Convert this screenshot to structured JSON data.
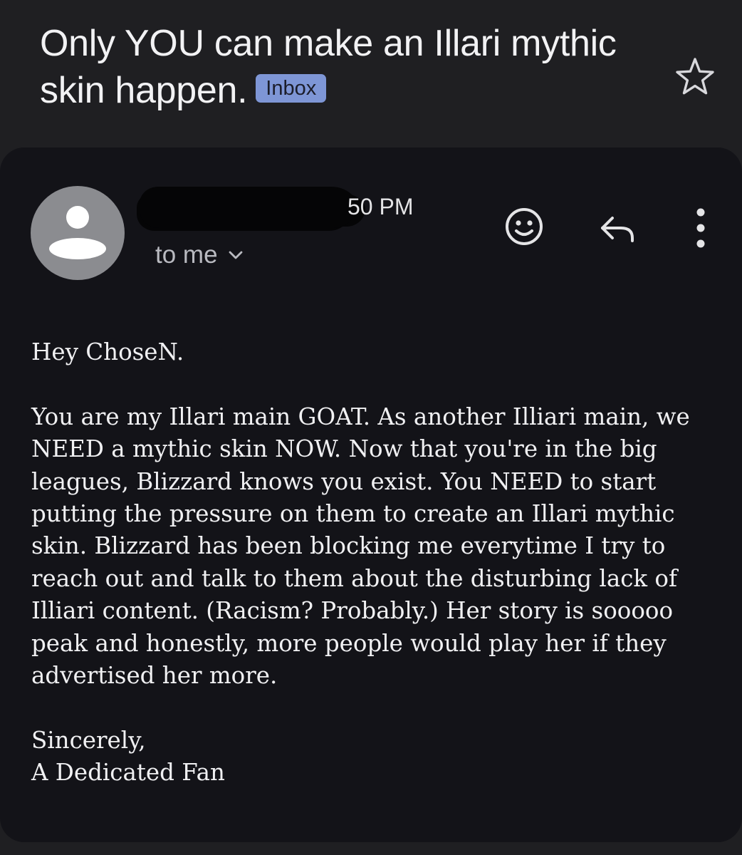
{
  "email": {
    "subject": "Only YOU can make an Illari mythic skin happen.",
    "label": "Inbox",
    "time": "50 PM",
    "recipient": "to me",
    "greeting": "Hey ChoseN.",
    "body": "You are my Illari main GOAT. As another Illiari main, we NEED a mythic skin NOW. Now that you're in the big leagues, Blizzard knows you exist. You NEED to start putting the pressure on them to create an Illari mythic skin. Blizzard has been blocking me everytime I try to reach out and talk to them about the disturbing lack of Illiari content. (Racism? Probably.) Her story is sooooo peak and honestly, more people would play her if they advertised her more.",
    "closing": "Sincerely,",
    "signature": "A Dedicated Fan"
  },
  "icons": {
    "star": "star-outline-icon",
    "avatar": "person-icon",
    "chevron": "chevron-down-icon",
    "emoji": "smiley-icon",
    "reply": "reply-icon",
    "more": "more-vertical-icon"
  },
  "colors": {
    "background": "#1f1f22",
    "card": "#131318",
    "badge": "#7e96d6",
    "avatar": "#8b8c90"
  }
}
